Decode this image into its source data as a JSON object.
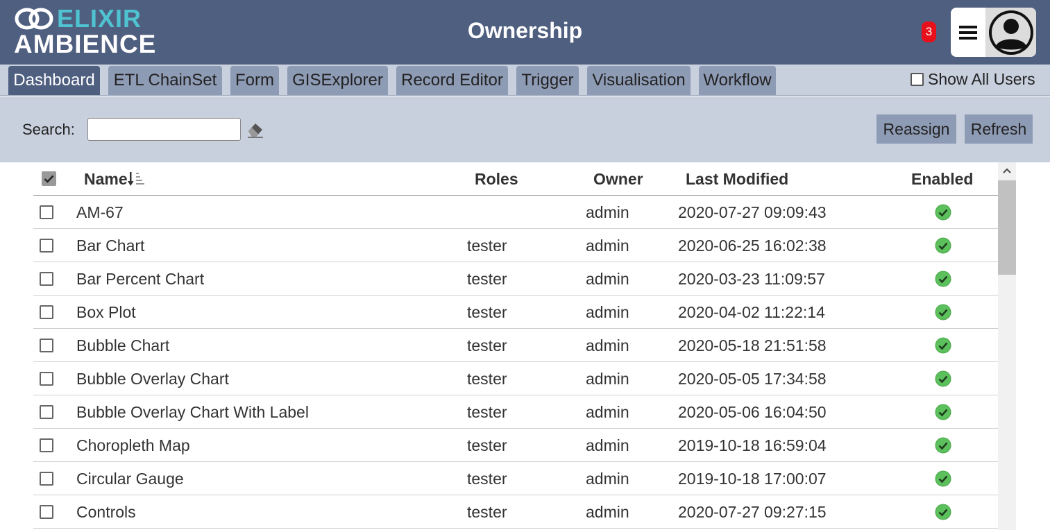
{
  "header": {
    "logo_top": "ELIXIR",
    "logo_bottom": "AMBIENCE",
    "title": "Ownership",
    "notification_count": "3"
  },
  "tabs": [
    {
      "label": "Dashboard",
      "active": true
    },
    {
      "label": "ETL ChainSet",
      "active": false
    },
    {
      "label": "Form",
      "active": false
    },
    {
      "label": "GISExplorer",
      "active": false
    },
    {
      "label": "Record Editor",
      "active": false
    },
    {
      "label": "Trigger",
      "active": false
    },
    {
      "label": "Visualisation",
      "active": false
    },
    {
      "label": "Workflow",
      "active": false
    }
  ],
  "show_all_users": {
    "label": "Show All Users",
    "checked": false
  },
  "toolbar": {
    "search_label": "Search:",
    "search_value": "",
    "reassign_label": "Reassign",
    "refresh_label": "Refresh"
  },
  "table": {
    "headers": {
      "name": "Name",
      "roles": "Roles",
      "owner": "Owner",
      "last_modified": "Last Modified",
      "enabled": "Enabled"
    },
    "sort": {
      "column": "name",
      "direction": "descending"
    },
    "rows": [
      {
        "name": "AM-67",
        "roles": "",
        "owner": "admin",
        "last_modified": "2020-07-27 09:09:43",
        "enabled": true
      },
      {
        "name": "Bar Chart",
        "roles": "tester",
        "owner": "admin",
        "last_modified": "2020-06-25 16:02:38",
        "enabled": true
      },
      {
        "name": "Bar Percent Chart",
        "roles": "tester",
        "owner": "admin",
        "last_modified": "2020-03-23 11:09:57",
        "enabled": true
      },
      {
        "name": "Box Plot",
        "roles": "tester",
        "owner": "admin",
        "last_modified": "2020-04-02 11:22:14",
        "enabled": true
      },
      {
        "name": "Bubble Chart",
        "roles": "tester",
        "owner": "admin",
        "last_modified": "2020-05-18 21:51:58",
        "enabled": true
      },
      {
        "name": "Bubble Overlay Chart",
        "roles": "tester",
        "owner": "admin",
        "last_modified": "2020-05-05 17:34:58",
        "enabled": true
      },
      {
        "name": "Bubble Overlay Chart With Label",
        "roles": "tester",
        "owner": "admin",
        "last_modified": "2020-05-06 16:04:50",
        "enabled": true
      },
      {
        "name": "Choropleth Map",
        "roles": "tester",
        "owner": "admin",
        "last_modified": "2019-10-18 16:59:04",
        "enabled": true
      },
      {
        "name": "Circular Gauge",
        "roles": "tester",
        "owner": "admin",
        "last_modified": "2019-10-18 17:00:07",
        "enabled": true
      },
      {
        "name": "Controls",
        "roles": "tester",
        "owner": "admin",
        "last_modified": "2020-07-27 09:27:15",
        "enabled": true
      }
    ]
  },
  "colors": {
    "header_bg": "#4f5f80",
    "logo_accent": "#4fc3d0",
    "toolbar_bg": "#c8d0de",
    "tab_bg": "#8e9bb5",
    "enabled_check": "#5cc05c",
    "badge": "#e8101a"
  },
  "icons": {
    "logo": "linked-rings-icon",
    "menu": "hamburger-icon",
    "avatar": "user-silhouette-icon",
    "clear_search": "eraser-icon",
    "sort": "sort-descending-icon",
    "enabled": "green-check-circle-icon",
    "scroll_up": "chevron-up-icon"
  }
}
